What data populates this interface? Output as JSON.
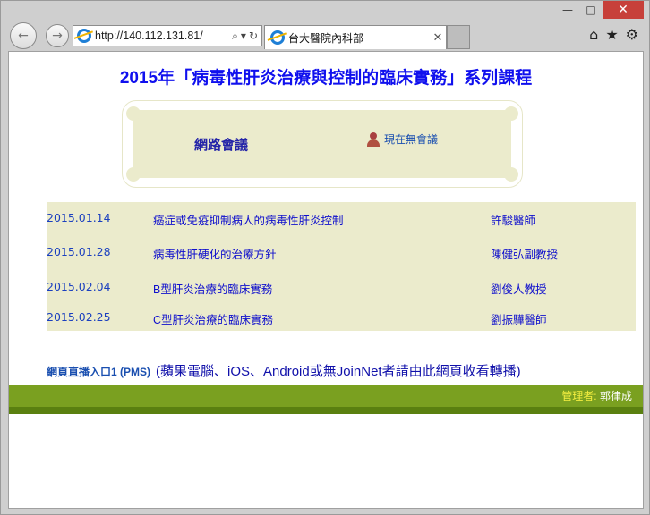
{
  "browser": {
    "window_controls": {
      "minimize": "—",
      "maximize": "□",
      "close": "✕"
    },
    "address_bar": {
      "url": "http://140.112.131.81/"
    },
    "tab": {
      "title": "台大醫院內科部"
    }
  },
  "page": {
    "title": "2015年「病毒性肝炎治療與控制的臨床實務」系列課程",
    "meeting": {
      "label": "網路會議",
      "status": "現在無會議"
    },
    "schedule": [
      {
        "date": "2015.01.14",
        "topic": "癌症或免疫抑制病人的病毒性肝炎控制",
        "speaker": "許駿醫師"
      },
      {
        "date": "2015.01.28",
        "topic": "病毒性肝硬化的治療方針",
        "speaker": "陳健弘副教授"
      },
      {
        "date": "2015.02.04",
        "topic": "B型肝炎治療的臨床實務",
        "speaker": "劉俊人教授"
      },
      {
        "date": "2015.02.25",
        "topic": "C型肝炎治療的臨床實務",
        "speaker": "劉振驊醫師"
      }
    ],
    "live": {
      "link": "網頁直播入口1 (PMS)",
      "note": "(蘋果電腦、iOS、Android或無JoinNet者請由此網頁收看轉播)"
    },
    "footer": {
      "admin_label": "管理者:",
      "admin_name": "郭律成"
    }
  },
  "colors": {
    "accent_blue": "#1010ee",
    "table_bg": "#ebebcc",
    "footer_green": "#7aa020",
    "admin_label": "#f4ee40"
  }
}
